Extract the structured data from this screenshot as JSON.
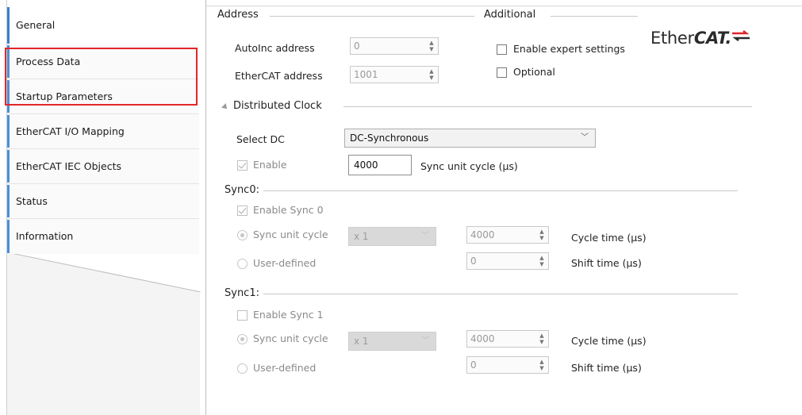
{
  "tabs": [
    {
      "label": "General"
    },
    {
      "label": "Process Data"
    },
    {
      "label": "Startup Parameters"
    },
    {
      "label": "EtherCAT I/O Mapping"
    },
    {
      "label": "EtherCAT IEC Objects"
    },
    {
      "label": "Status"
    },
    {
      "label": "Information"
    }
  ],
  "address": {
    "title": "Address",
    "autoinc_label": "AutoInc address",
    "autoinc_value": "0",
    "ethercat_label": "EtherCAT address",
    "ethercat_value": "1001"
  },
  "additional": {
    "title": "Additional",
    "expert_label": "Enable expert settings",
    "optional_label": "Optional"
  },
  "logo": {
    "prefix": "Ether",
    "bold": "CAT",
    "mark": "."
  },
  "dc": {
    "title": "Distributed Clock",
    "select_label": "Select DC",
    "select_value": "DC-Synchronous",
    "enable_label": "Enable",
    "cycle_value": "4000",
    "cycle_unit_label": "Sync unit cycle (µs)"
  },
  "sync0": {
    "title": "Sync0:",
    "enable_label": "Enable Sync 0",
    "sync_unit_label": "Sync unit cycle",
    "multiplier": "x 1",
    "cycle_value": "4000",
    "cycle_time_label": "Cycle time (µs)",
    "user_defined_label": "User-defined",
    "shift_value": "0",
    "shift_time_label": "Shift time (µs)"
  },
  "sync1": {
    "title": "Sync1:",
    "enable_label": "Enable Sync 1",
    "sync_unit_label": "Sync unit cycle",
    "multiplier": "x 1",
    "cycle_value": "4000",
    "cycle_time_label": "Cycle time (µs)",
    "user_defined_label": "User-defined",
    "shift_value": "0",
    "shift_time_label": "Shift time (µs)"
  },
  "colors": {
    "highlight": "#e3262a",
    "accent": "#3b7fd0"
  }
}
